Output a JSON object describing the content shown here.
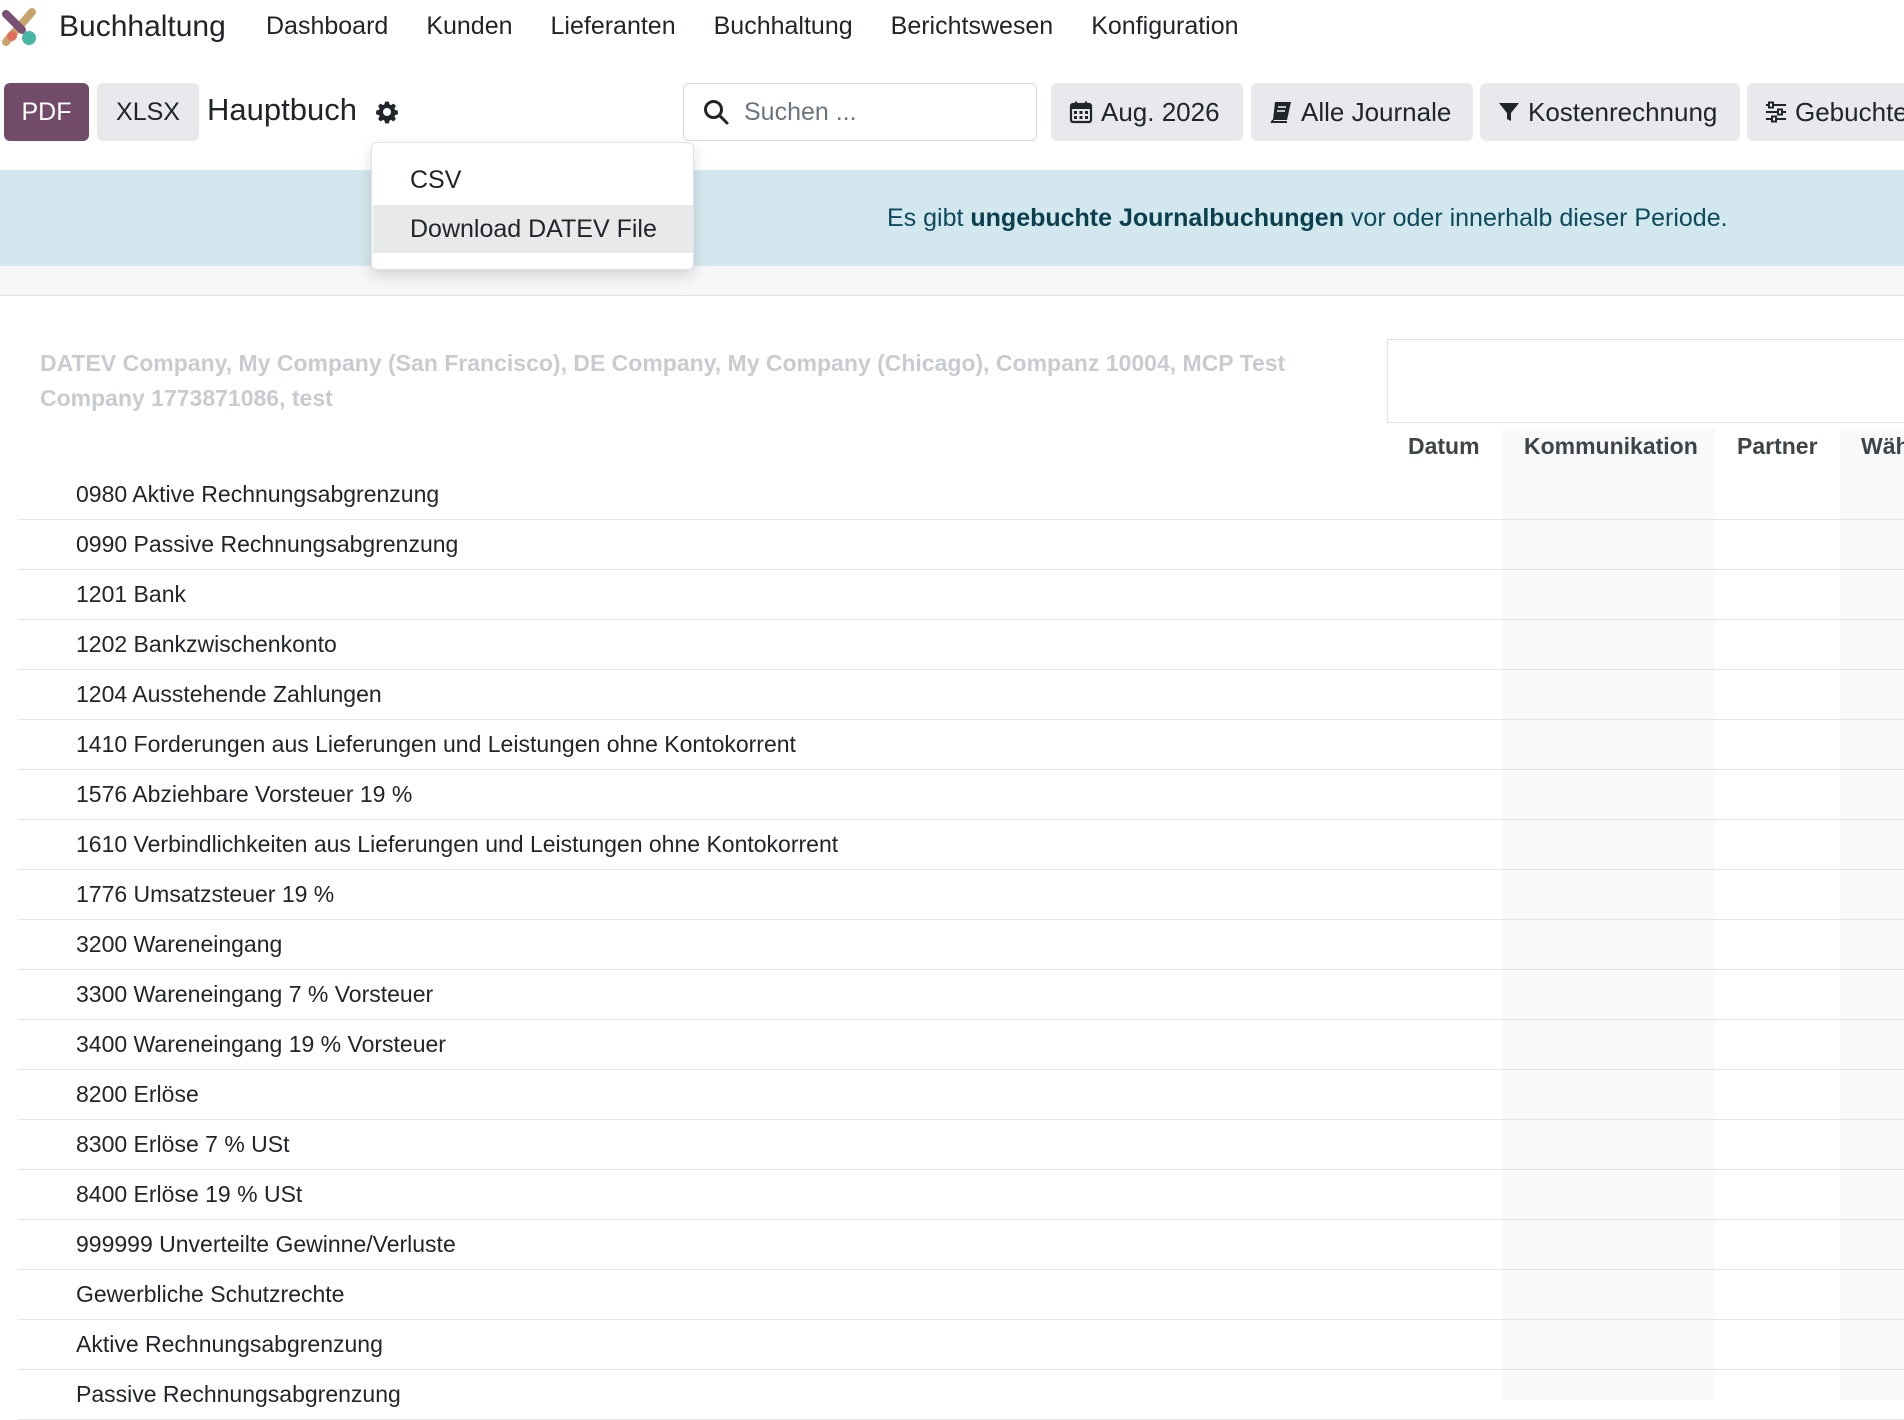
{
  "app": {
    "title": "Buchhaltung",
    "menu": [
      "Dashboard",
      "Kunden",
      "Lieferanten",
      "Buchhaltung",
      "Berichtswesen",
      "Konfiguration"
    ]
  },
  "toolbar": {
    "pdf_label": "PDF",
    "xlsx_label": "XLSX",
    "report_title": "Hauptbuch",
    "search_placeholder": "Suchen ...",
    "date_filter": "Aug. 2026",
    "journals_filter": "Alle Journale",
    "analytic_filter": "Kostenrechnung",
    "posted_filter": "Gebuchte"
  },
  "dropdown": {
    "items": [
      "CSV",
      "Download DATEV File"
    ]
  },
  "banner": {
    "prefix": "Es gibt ",
    "link": "ungebuchte Journalbuchungen",
    "suffix": " vor oder innerhalb dieser Periode."
  },
  "report": {
    "companies": "DATEV Company, My Company (San Francisco), DE Company, My Company (Chicago), Companz 10004, MCP Test Company 1773871086, test",
    "columns": [
      "Datum",
      "Kommunikation",
      "Partner",
      "Wäh"
    ],
    "accounts": [
      "0980 Aktive Rechnungsabgrenzung",
      "0990 Passive Rechnungsabgrenzung",
      "1201 Bank",
      "1202 Bankzwischenkonto",
      "1204 Ausstehende Zahlungen",
      "1410 Forderungen aus Lieferungen und Leistungen ohne Kontokorrent",
      "1576 Abziehbare Vorsteuer 19 %",
      "1610 Verbindlichkeiten aus Lieferungen und Leistungen ohne Kontokorrent",
      "1776 Umsatzsteuer 19 %",
      "3200 Wareneingang",
      "3300 Wareneingang 7 % Vorsteuer",
      "3400 Wareneingang 19 % Vorsteuer",
      "8200 Erlöse",
      "8300 Erlöse 7 % USt",
      "8400 Erlöse 19 % USt",
      "999999 Unverteilte Gewinne/Verluste",
      "Gewerbliche Schutzrechte",
      "Aktive Rechnungsabgrenzung",
      "Passive Rechnungsabgrenzung"
    ]
  },
  "colors": {
    "primary": "#714b67",
    "banner_bg": "#d3e8ee",
    "banner_text": "#0c4a5c",
    "secondary_btn": "#e7e9ed"
  },
  "icons": [
    "app-logo-icon",
    "gear-icon",
    "search-icon",
    "calendar-icon",
    "book-icon",
    "filter-icon",
    "sliders-icon"
  ]
}
